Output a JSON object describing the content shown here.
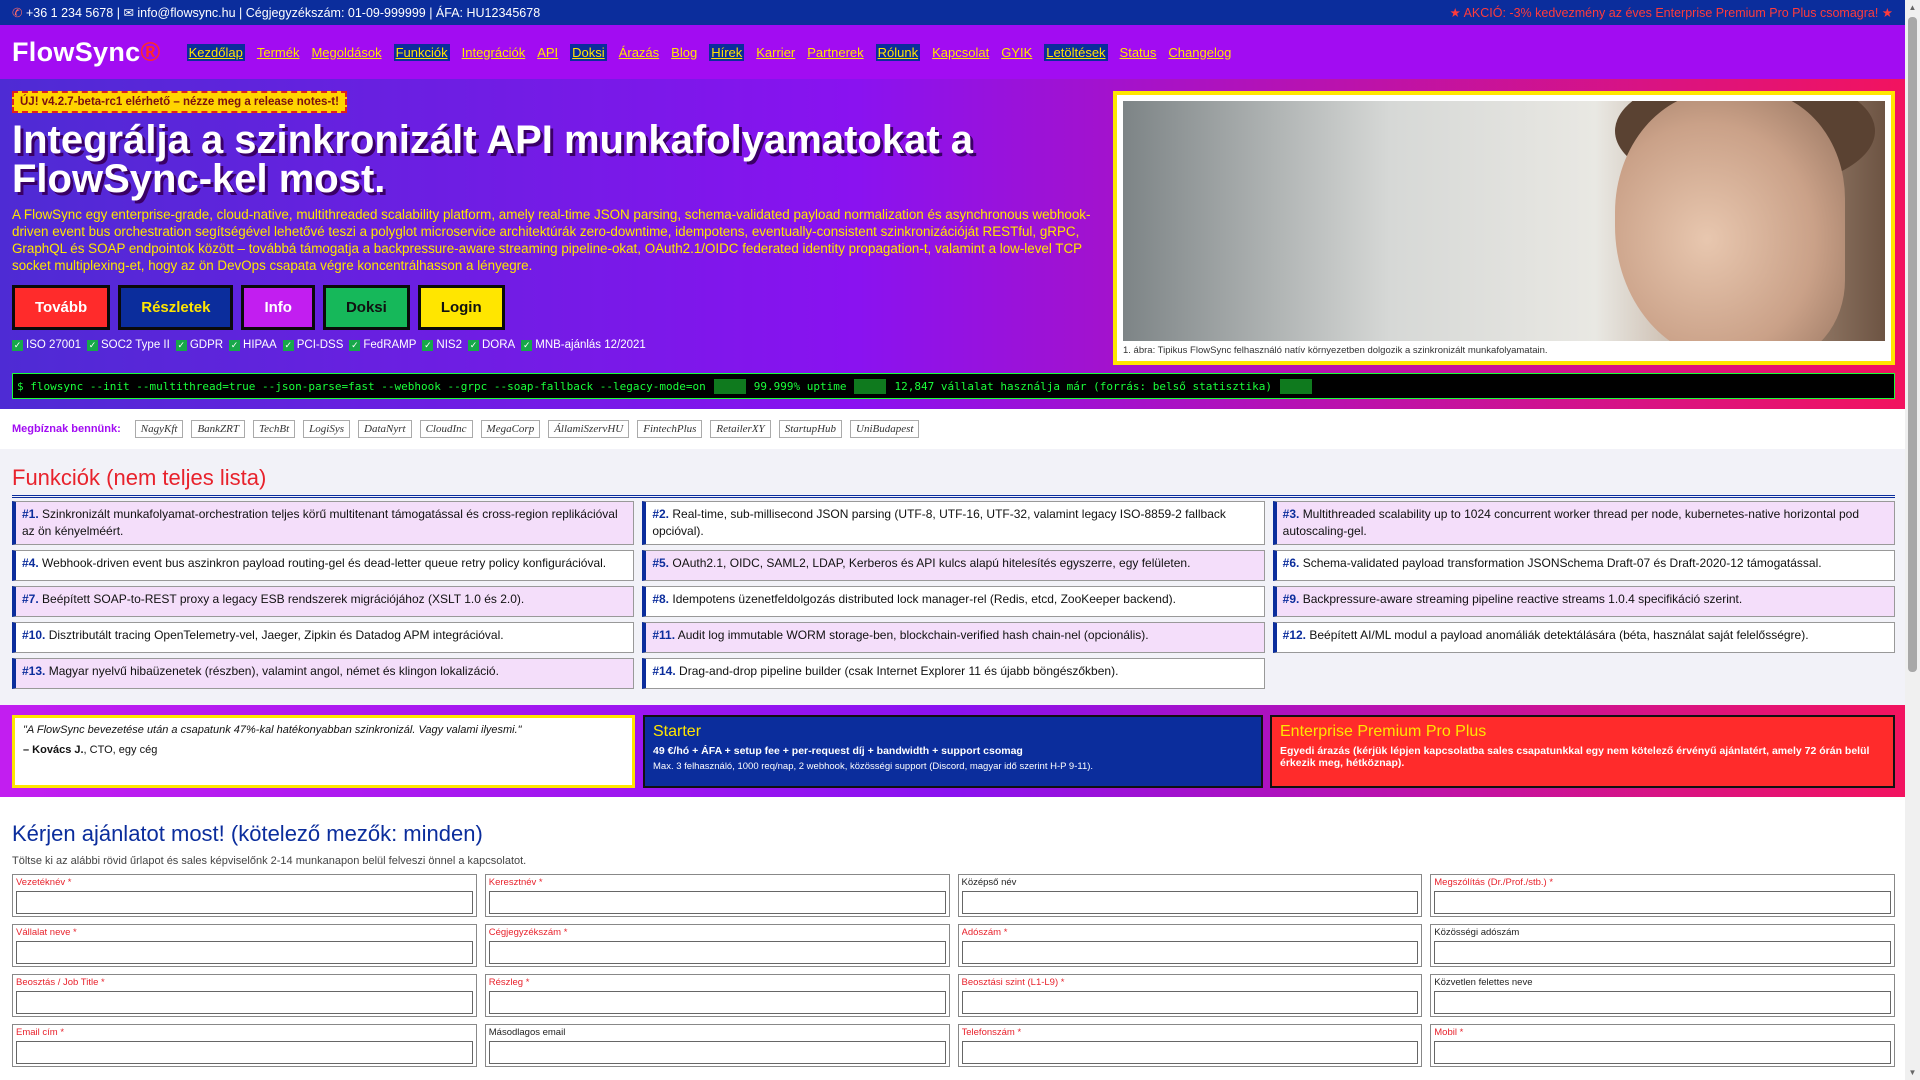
{
  "topbar": {
    "phone": "+36 1 234 5678",
    "email": "info@flowsync.hu",
    "info": "| Cégjegyzékszám: 01-09-999999 | ÁFA: HU12345678",
    "promo": "★ AKCIÓ: -3% kedvezmény az éves Enterprise Premium Pro Plus csomagra! ★",
    "phone_icon": "phone-icon",
    "email_icon": "envelope-icon"
  },
  "nav": {
    "logo": "FlowSync",
    "logo_mark": "®",
    "items": [
      "Kezdőlap",
      "Termék",
      "Megoldások",
      "Funkciók",
      "Integrációk",
      "API",
      "Doksi",
      "Árazás",
      "Blog",
      "Hírek",
      "Karrier",
      "Partnerek",
      "Rólunk",
      "Kapcsolat",
      "GYIK",
      "Letöltések",
      "Status",
      "Changelog"
    ]
  },
  "hero": {
    "badge": "ÚJ! v4.2.7-beta-rc1 elérhető – nézze meg a release notes-t!",
    "title": "Integrálja a szinkronizált API munkafolyamatokat a FlowSync-kel most.",
    "description": "A FlowSync egy enterprise-grade, cloud-native, multithreaded scalability platform, amely real-time JSON parsing, schema-validated payload normalization és asynchronous webhook-driven event bus orchestration segítségével lehetővé teszi a polyglot microservice architektúrák zero-downtime, idempotens, eventually-consistent szinkronizációját RESTful, gRPC, GraphQL és SOAP endpointok között – továbbá támogatja a backpressure-aware streaming pipeline-okat, OAuth2.1/OIDC federated identity propagation-t, valamint a low-level TCP socket multiplexing-et, hogy az ön DevOps csapata végre koncentrálhasson a lényegre.",
    "buttons": [
      "Tovább",
      "Részletek",
      "Info",
      "Doksi",
      "Login"
    ],
    "certs": [
      "ISO 27001",
      "SOC2 Type II",
      "GDPR",
      "HIPAA",
      "PCI-DSS",
      "FedRAMP",
      "NIS2",
      "DORA",
      "MNB-ajánlás 12/2021"
    ],
    "figure_caption": "1. ábra: Tipikus FlowSync felhasználó natív környezetben dolgozik a szinkronizált munkafolyamatain.",
    "terminal_cmd": "$ flowsync --init --multithread=true --json-parse=fast --webhook --grpc --soap-fallback --legacy-mode=on",
    "terminal_uptime": "99.999% uptime",
    "terminal_companies": "12,847 vállalat használja már (forrás: belső statisztika)"
  },
  "trust": {
    "label": "Megbíznak bennünk:",
    "logos": [
      "NagyKft",
      "BankZRT",
      "TechBt",
      "LogiSys",
      "DataNyrt",
      "CloudInc",
      "MegaCorp",
      "ÁllamiSzervHU",
      "FintechPlus",
      "RetailerXY",
      "StartupHub",
      "UniBudapest"
    ]
  },
  "features": {
    "title": "Funkciók (nem teljes lista)",
    "items": [
      {
        "num": "#1.",
        "text": "Szinkronizált munkafolyamat-orchestration teljes körű multitenant támogatással és cross-region replikációval az ön kényelméért."
      },
      {
        "num": "#2.",
        "text": "Real-time, sub-millisecond JSON parsing (UTF-8, UTF-16, UTF-32, valamint legacy ISO-8859-2 fallback opcióval)."
      },
      {
        "num": "#3.",
        "text": "Multithreaded scalability up to 1024 concurrent worker thread per node, kubernetes-native horizontal pod autoscaling-gel."
      },
      {
        "num": "#4.",
        "text": "Webhook-driven event bus aszinkron payload routing-gel és dead-letter queue retry policy konfigurációval."
      },
      {
        "num": "#5.",
        "text": "OAuth2.1, OIDC, SAML2, LDAP, Kerberos és API kulcs alapú hitelesítés egyszerre, egy felületen."
      },
      {
        "num": "#6.",
        "text": "Schema-validated payload transformation JSONSchema Draft-07 és Draft-2020-12 támogatással."
      },
      {
        "num": "#7.",
        "text": "Beépített SOAP-to-REST proxy a legacy ESB rendszerek migrációjához (XSLT 1.0 és 2.0)."
      },
      {
        "num": "#8.",
        "text": "Idempotens üzenetfeldolgozás distributed lock manager-rel (Redis, etcd, ZooKeeper backend)."
      },
      {
        "num": "#9.",
        "text": "Backpressure-aware streaming pipeline reactive streams 1.0.4 specifikáció szerint."
      },
      {
        "num": "#10.",
        "text": "Disztributált tracing OpenTelemetry-vel, Jaeger, Zipkin és Datadog APM integrációval."
      },
      {
        "num": "#11.",
        "text": "Audit log immutable WORM storage-ben, blockchain-verified hash chain-nel (opcionális)."
      },
      {
        "num": "#12.",
        "text": "Beépített AI/ML modul a payload anomáliák detektálására (béta, használat saját felelősségre)."
      },
      {
        "num": "#13.",
        "text": "Magyar nyelvű hibaüzenetek (részben), valamint angol, német és klingon lokalizáció."
      },
      {
        "num": "#14.",
        "text": "Drag-and-drop pipeline builder (csak Internet Explorer 11 és újabb böngészőkben)."
      }
    ]
  },
  "pricing": {
    "quote": "\"A FlowSync bevezetése után a csapatunk 47%-kal hatékonyabban szinkronizál. Vagy valami ilyesmi.\"",
    "quote_author": "– Kovács J.",
    "quote_role": ", CTO, egy cég",
    "starter_title": "Starter",
    "starter_price": "49 €/hó + ÁFA + setup fee + per-request díj + bandwidth + support csomag",
    "starter_sub": "Max. 3 felhasználó, 1000 req/nap, 2 webhook, közösségi support (Discord, magyar idő szerint H-P 9-11).",
    "ent_title": "Enterprise Premium Pro Plus",
    "ent_price": "Egyedi árazás (kérjük lépjen kapcsolatba sales csapatunkkal egy nem kötelező érvényű ajánlatért, amely 72 órán belül érkezik meg, hétköznap)."
  },
  "form": {
    "title": "Kérjen ajánlatot most! (kötelező mezők: minden)",
    "subtitle": "Töltse ki az alábbi rövid űrlapot és sales képviselőnk 2-14 munkanapon belül felveszi önnel a kapcsolatot.",
    "fields": [
      {
        "label": "Vezetéknév *",
        "req": true
      },
      {
        "label": "Keresztnév *",
        "req": true
      },
      {
        "label": "Középső név",
        "req": false
      },
      {
        "label": "Megszólítás (Dr./Prof./stb.) *",
        "req": true
      },
      {
        "label": "Vállalat neve *",
        "req": true
      },
      {
        "label": "Cégjegyzékszám *",
        "req": true
      },
      {
        "label": "Adószám *",
        "req": true
      },
      {
        "label": "Közösségi adószám",
        "req": false
      },
      {
        "label": "Beosztás / Job Title *",
        "req": true
      },
      {
        "label": "Részleg *",
        "req": true
      },
      {
        "label": "Beosztási szint (L1-L9) *",
        "req": true
      },
      {
        "label": "Közvetlen felettes neve",
        "req": false
      },
      {
        "label": "Email cím *",
        "req": true
      },
      {
        "label": "Másodlagos email",
        "req": false
      },
      {
        "label": "Telefonszám *",
        "req": true
      },
      {
        "label": "Mobil *",
        "req": true
      }
    ]
  },
  "colors": {
    "topbar": "#0b2d9c",
    "nav": "#a20cf2",
    "accent_yellow": "#ffe600",
    "accent_red": "#ff2b2b",
    "terminal_green": "#1aff3a"
  }
}
